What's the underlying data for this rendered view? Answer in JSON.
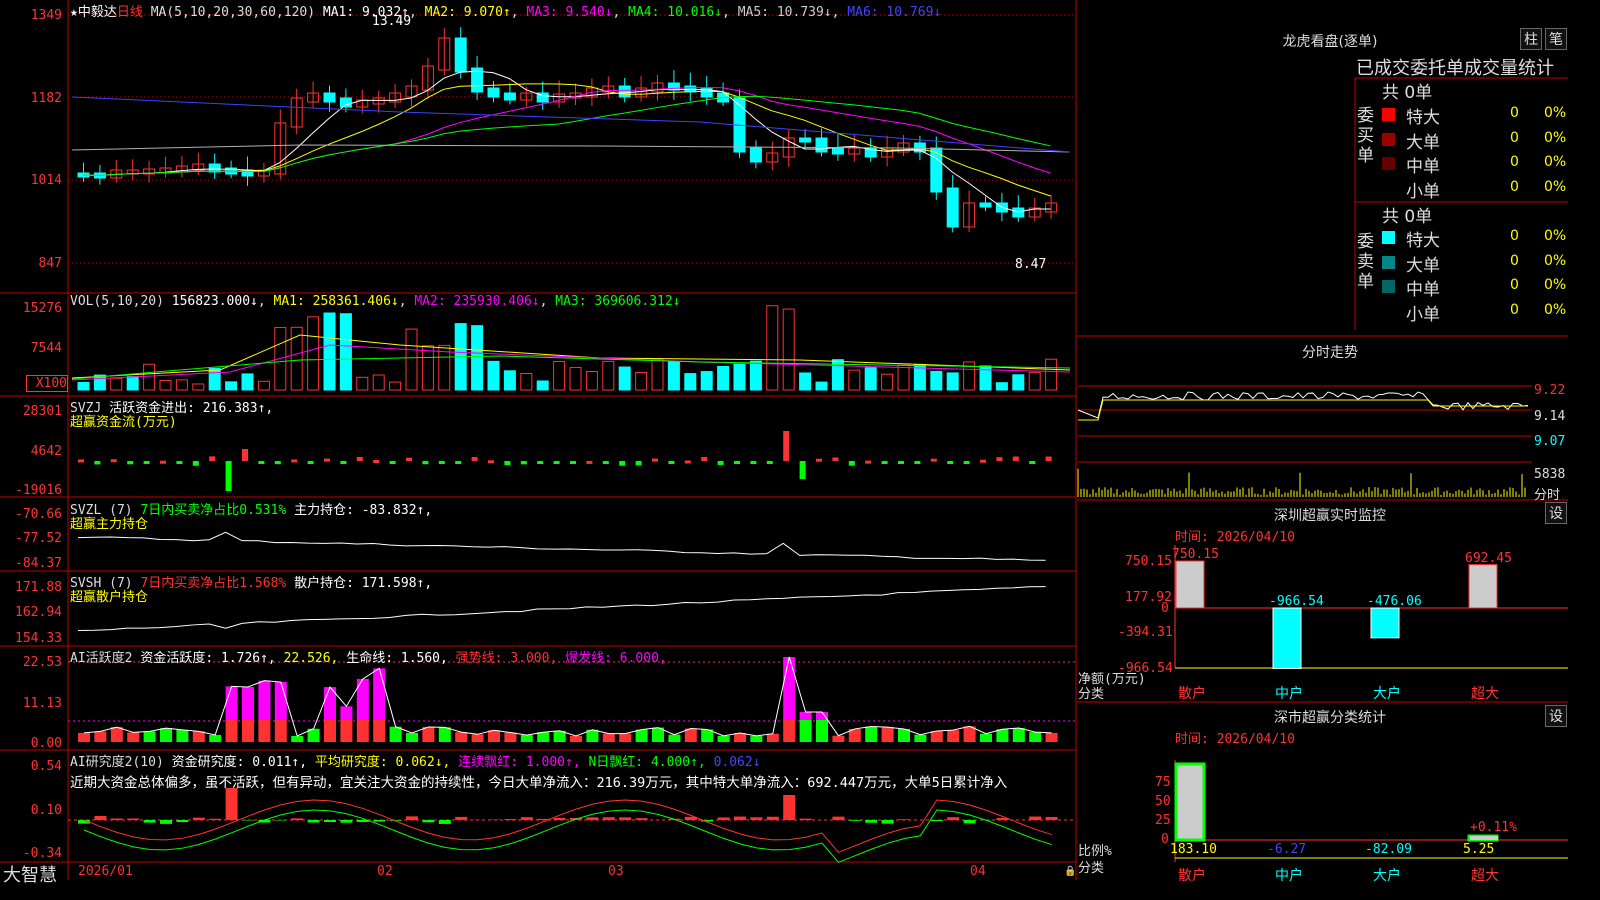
{
  "stock": {
    "star": "★",
    "name": "中毅达",
    "period": "日线"
  },
  "ma_header": {
    "label": "MA(5,10,20,30,60,120)",
    "ma1": "MA1: 9.032↑",
    "ma2": "MA2: 9.070↑",
    "ma3": "MA3: 9.540↓",
    "ma4": "MA4: 10.016↓",
    "ma5": "MA5: 10.739↓",
    "ma6": "MA6: 10.769↓"
  },
  "price_axis": [
    "1349",
    "1182",
    "1014",
    "847"
  ],
  "price_annotations": {
    "high": "13.49",
    "low": "8.47"
  },
  "vol_header": {
    "label": "VOL(5,10,20)",
    "value": "156823.000↓",
    "ma1": "MA1: 258361.406↓",
    "ma2": "MA2: 235930.406↓",
    "ma3": "MA3: 369606.312↓"
  },
  "vol_axis": [
    "15276",
    "7544",
    "X100"
  ],
  "svzj_header": {
    "label": "SVZJ",
    "text": "活跃资金进出: 216.383↑,",
    "sub": "超赢资金流(万元)"
  },
  "svzj_axis": [
    "28301",
    "4642",
    "-19016"
  ],
  "svzl_header": {
    "label": "SVZL (7)",
    "text1": "7日内买卖净占比0.531%",
    "text2": "主力持仓: -83.832↑,",
    "sub": "超赢主力持仓"
  },
  "svzl_axis": [
    "-70.66",
    "-77.52",
    "-84.37"
  ],
  "svsh_header": {
    "label": "SVSH (7)",
    "text1": "7日内买卖净占比1.568%",
    "text2": "散户持仓: 171.598↑,",
    "sub": "超赢散户持仓"
  },
  "svsh_axis": [
    "171.88",
    "162.94",
    "154.33"
  ],
  "ai1_header": {
    "label": "AI活跃度2",
    "a": "资金活跃度: 1.726↑,",
    "b": "22.526,",
    "c": "生命线: 1.560,",
    "d": "强势线: 3.000,",
    "e": "爆发线: 6.000,"
  },
  "ai1_axis": [
    "22.53",
    "11.13",
    "0.00"
  ],
  "ai2_header": {
    "label": "AI研究度2(10)",
    "a": "资金研究度: 0.011↑,",
    "b": "平均研究度: 0.062↓,",
    "c": "连续飘红: 1.000↑,",
    "d": "N日飘红: 4.000↑,",
    "e": "0.062↓",
    "desc": "近期大资金总体偏多，虽不活跃，但有异动，宜关注大资金的持续性，今日大单净流入：216.39万元，其中特大单净流入：692.447万元，大单5日累计净入"
  },
  "ai2_axis": [
    "0.54",
    "0.10",
    "-0.34"
  ],
  "date_axis": [
    "2026/01",
    "02",
    "03",
    "04"
  ],
  "brand": "大智慧",
  "longhu": {
    "title": "龙虎看盘(逐单)",
    "btn1": "柱",
    "btn2": "笔",
    "tab": "已成交委托单成交量统计",
    "buy_label": "委买单",
    "sell_label": "委卖单",
    "buy_total": "共 0单",
    "sell_total": "共 0单",
    "buy_rows": [
      {
        "name": "特大",
        "val": "0",
        "pct": "0%",
        "color": "#ff0000"
      },
      {
        "name": "大单",
        "val": "0",
        "pct": "0%",
        "color": "#990000"
      },
      {
        "name": "中单",
        "val": "0",
        "pct": "0%",
        "color": "#660000"
      },
      {
        "name": "小单",
        "val": "0",
        "pct": "0%",
        "color": "#000000"
      }
    ],
    "sell_rows": [
      {
        "name": "特大",
        "val": "0",
        "pct": "0%",
        "color": "#00ffff"
      },
      {
        "name": "大单",
        "val": "0",
        "pct": "0%",
        "color": "#008888"
      },
      {
        "name": "中单",
        "val": "0",
        "pct": "0%",
        "color": "#006666"
      },
      {
        "name": "小单",
        "val": "0",
        "pct": "0%",
        "color": "#000000"
      }
    ]
  },
  "intraday": {
    "title": "分时走势",
    "levels": [
      "9.22",
      "9.14",
      "9.07"
    ],
    "vol": "5838",
    "vol_label": "分时"
  },
  "sz_monitor": {
    "title": "深圳超赢实时监控",
    "btn": "设",
    "time": "时间: 2026/04/10",
    "axis": [
      "750.15",
      "177.92",
      "0",
      "-394.31",
      "-966.54"
    ],
    "axis_label1": "净额(万元)",
    "axis_label2": "分类",
    "bars": [
      {
        "cat": "散户",
        "value": 750.15,
        "label": "750.15"
      },
      {
        "cat": "中户",
        "value": -966.54,
        "label": "-966.54"
      },
      {
        "cat": "大户",
        "value": -476.06,
        "label": "-476.06"
      },
      {
        "cat": "超大",
        "value": 692.45,
        "label": "692.45"
      }
    ]
  },
  "sz_class": {
    "title": "深市超赢分类统计",
    "btn": "设",
    "time": "时间: 2026/04/10",
    "axis": [
      "75",
      "50",
      "25",
      "0"
    ],
    "axis_label1": "比例%",
    "axis_label2": "分类",
    "extra": "+0.11%",
    "bars": [
      {
        "cat": "散户",
        "value": 183.1,
        "label": "183.10"
      },
      {
        "cat": "中户",
        "value": -6.27,
        "label": "-6.27"
      },
      {
        "cat": "大户",
        "value": -82.09,
        "label": "-82.09"
      },
      {
        "cat": "超大",
        "value": 5.25,
        "label": "5.25"
      }
    ]
  },
  "colors": {
    "up": "#ff3232",
    "down": "#00ffff",
    "grid": "#c00000",
    "ma1": "#ffffff",
    "ma2": "#ffff00",
    "ma3": "#ff00ff",
    "ma4": "#00ff00",
    "ma5": "#b0b0b0",
    "ma6": "#4040ff"
  }
}
